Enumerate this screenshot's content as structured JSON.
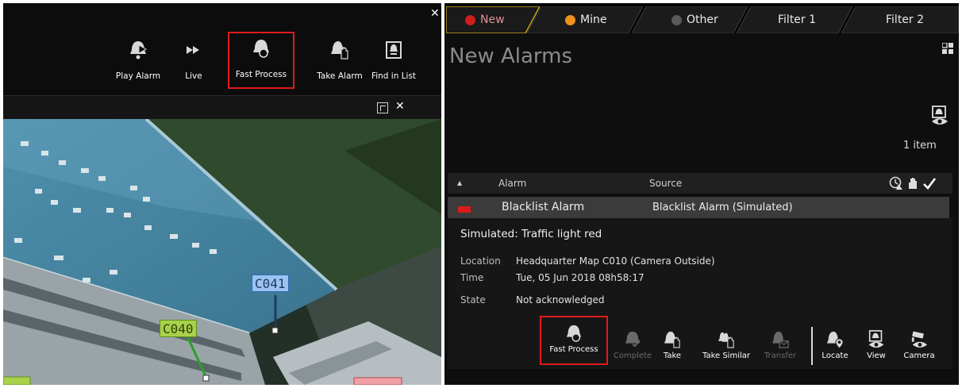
{
  "left_toolbar": {
    "buttons": [
      {
        "label": "Play Alarm",
        "icon": "bell-play-icon"
      },
      {
        "label": "Live",
        "icon": "fast-forward-icon"
      },
      {
        "label": "Fast Process",
        "icon": "bell-refresh-icon",
        "highlighted": true
      },
      {
        "label": "Take Alarm",
        "icon": "bell-hand-icon"
      },
      {
        "label": "Find in List",
        "icon": "find-in-list-icon"
      }
    ]
  },
  "video": {
    "cameras": [
      {
        "label": "C041",
        "color": "#9bc3f1"
      },
      {
        "label": "C040",
        "color": "#a9d14a"
      }
    ]
  },
  "tabs": [
    {
      "label": "New",
      "dot_color": "#d01c1c",
      "active": true
    },
    {
      "label": "Mine",
      "dot_color": "#f0921a",
      "active": false
    },
    {
      "label": "Other",
      "dot_color": "#5a5a5a",
      "active": false
    },
    {
      "label": "Filter 1",
      "active": false
    },
    {
      "label": "Filter 2",
      "active": false
    }
  ],
  "panel": {
    "title": "New Alarms",
    "item_count": "1 item"
  },
  "list": {
    "headers": {
      "alarm": "Alarm",
      "source": "Source"
    },
    "rows": [
      {
        "alarm": "Blacklist Alarm",
        "source": "Blacklist Alarm (Simulated)",
        "priority_color": "#d91b1b"
      }
    ]
  },
  "detail": {
    "description": "Simulated: Traffic light red",
    "fields": [
      {
        "key": "Location",
        "value": "Headquarter Map C010 (Camera Outside)"
      },
      {
        "key": "Time",
        "value": "Tue, 05 Jun 2018  08h58:17"
      },
      {
        "key": "State",
        "value": "Not acknowledged"
      }
    ]
  },
  "actions": [
    {
      "label": "Fast Process",
      "icon": "bell-refresh-icon",
      "enabled": true,
      "highlighted": true
    },
    {
      "label": "Complete",
      "icon": "bell-check-icon",
      "enabled": false
    },
    {
      "label": "Take",
      "icon": "bell-hand-icon",
      "enabled": true
    },
    {
      "label": "Take Similar",
      "icon": "bell-hand-multi-icon",
      "enabled": true
    },
    {
      "label": "Transfer",
      "icon": "bell-envelope-icon",
      "enabled": false
    },
    {
      "label": "Locate",
      "icon": "bell-pin-icon",
      "enabled": true
    },
    {
      "label": "View",
      "icon": "view-eye-icon",
      "enabled": true
    },
    {
      "label": "Camera",
      "icon": "camera-eye-icon",
      "enabled": true
    }
  ],
  "colors": {
    "highlight_border": "#e11b1b",
    "active_tab_border": "#c9a21a",
    "background": "#0e0e0e"
  }
}
